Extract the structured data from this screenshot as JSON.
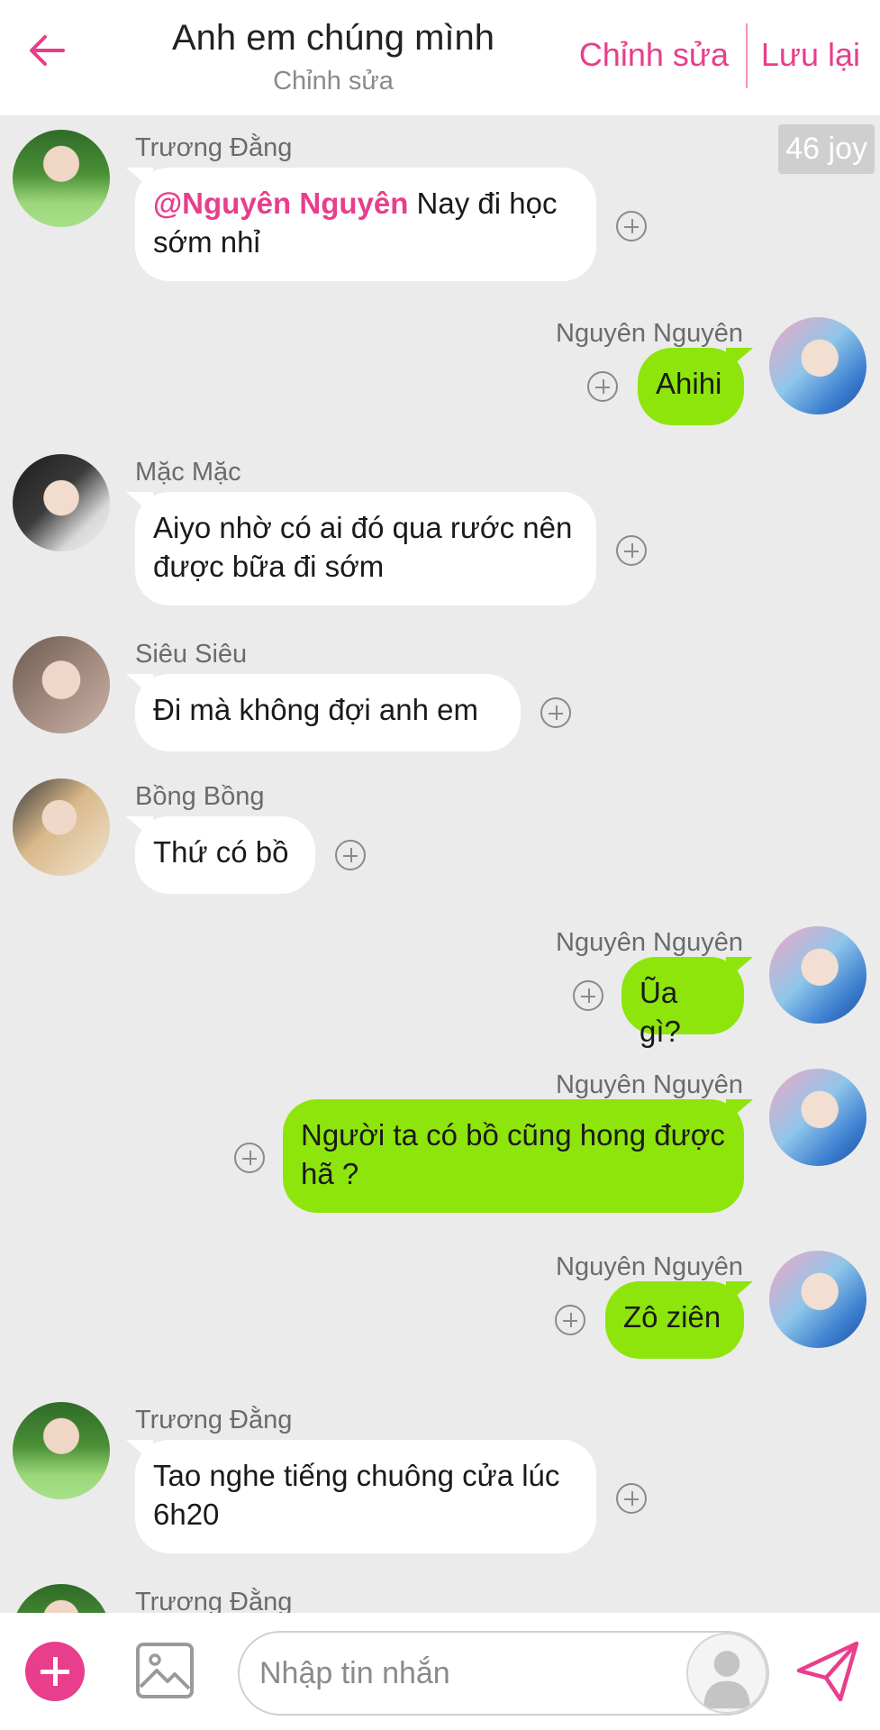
{
  "header": {
    "title": "Anh em chúng mình",
    "subtitle": "Chỉnh sửa",
    "edit_label": "Chỉnh sửa",
    "save_label": "Lưu lại"
  },
  "joy_badge": "46 joy",
  "messages": [
    {
      "sender": "Trương Đằng",
      "side": "left",
      "mention": "@Nguyên Nguyên",
      "text": " Nay đi học sớm nhỉ"
    },
    {
      "sender": "Nguyên Nguyên",
      "side": "right",
      "text": "Ahihi"
    },
    {
      "sender": "Mặc Mặc",
      "side": "left",
      "text": "Aiyo nhờ có ai đó qua rước nên được bữa đi sớm"
    },
    {
      "sender": "Siêu Siêu",
      "side": "left",
      "text": "Đi mà không đợi anh em"
    },
    {
      "sender": "Bồng Bồng",
      "side": "left",
      "text": "Thứ có bồ"
    },
    {
      "sender": "Nguyên Nguyên",
      "side": "right",
      "text": "Ũa gì?"
    },
    {
      "sender": "Nguyên Nguyên",
      "side": "right",
      "text": "Người ta có bồ cũng hong được hã ?"
    },
    {
      "sender": "Nguyên Nguyên",
      "side": "right",
      "text": "Zô ziên"
    },
    {
      "sender": "Trương Đằng",
      "side": "left",
      "text": "Tao nghe tiếng chuông cửa lúc 6h20"
    },
    {
      "sender": "Trương Đằng",
      "side": "left",
      "text": ""
    }
  ],
  "input": {
    "placeholder": "Nhập tin nhắn"
  },
  "colors": {
    "accent": "#e83e8c",
    "bubble_self": "#8ee50c",
    "bubble_other": "#ffffff",
    "background": "#ebebeb"
  },
  "icons": [
    "back-arrow-icon",
    "plus-icon",
    "image-icon",
    "voice-avatar-icon",
    "send-icon",
    "add-reaction-icon"
  ]
}
